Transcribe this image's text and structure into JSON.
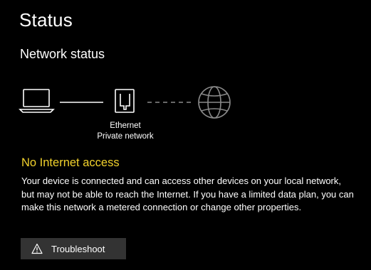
{
  "page": {
    "title": "Status"
  },
  "network_status": {
    "section_title": "Network status",
    "diagram": {
      "device_icon": "laptop-icon",
      "adapter_icon": "ethernet-port-icon",
      "internet_icon": "globe-icon",
      "adapter_name": "Ethernet",
      "network_profile": "Private network",
      "device_link": "connected",
      "internet_link": "disconnected"
    },
    "connectivity": {
      "heading": "No Internet access",
      "description": "Your device is connected and can access other devices on your local network, but may not be able to reach the Internet. If you have a limited data plan, you can make this network a metered connection or change other properties."
    },
    "troubleshoot": {
      "label": "Troubleshoot",
      "icon": "warning-triangle-icon"
    }
  },
  "colors": {
    "background": "#000000",
    "text": "#ffffff",
    "warning_text": "#f2d22c",
    "button_bg": "#333333",
    "inactive_link": "#8a8a8a"
  }
}
